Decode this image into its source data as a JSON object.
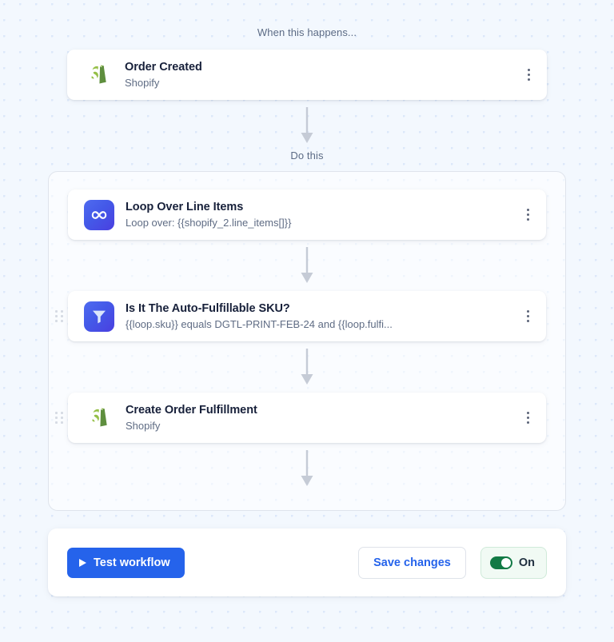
{
  "trigger_section": {
    "label": "When this happens...",
    "card": {
      "title": "Order Created",
      "subtitle": "Shopify",
      "icon": "shopify-icon",
      "menu_icon": "kebab-menu-icon"
    }
  },
  "action_section": {
    "label": "Do this",
    "steps": [
      {
        "title": "Loop Over Line Items",
        "subtitle": "Loop over: {{shopify_2.line_items[]}}",
        "icon": "loop-icon",
        "menu_icon": "kebab-menu-icon",
        "drag_handle": false
      },
      {
        "title": "Is It The Auto-Fulfillable SKU?",
        "subtitle": "{{loop.sku}} equals DGTL-PRINT-FEB-24 and {{loop.fulfi...",
        "icon": "filter-icon",
        "menu_icon": "kebab-menu-icon",
        "drag_handle": true
      },
      {
        "title": "Create Order Fulfillment",
        "subtitle": "Shopify",
        "icon": "shopify-icon",
        "menu_icon": "kebab-menu-icon",
        "drag_handle": true
      }
    ]
  },
  "footer": {
    "test_button_label": "Test workflow",
    "test_button_icon": "play-icon",
    "save_button_label": "Save changes",
    "toggle_label": "On",
    "toggle_state": "on"
  },
  "colors": {
    "background": "#f3f8fe",
    "dot": "#dce8fa",
    "primary_blue": "#2563eb",
    "toggle_green": "#127a45",
    "toggle_pill_bg": "#f1faf4",
    "card_white": "#ffffff",
    "muted_text": "#5f6c84",
    "arrow_gray": "#c5cbd6"
  }
}
